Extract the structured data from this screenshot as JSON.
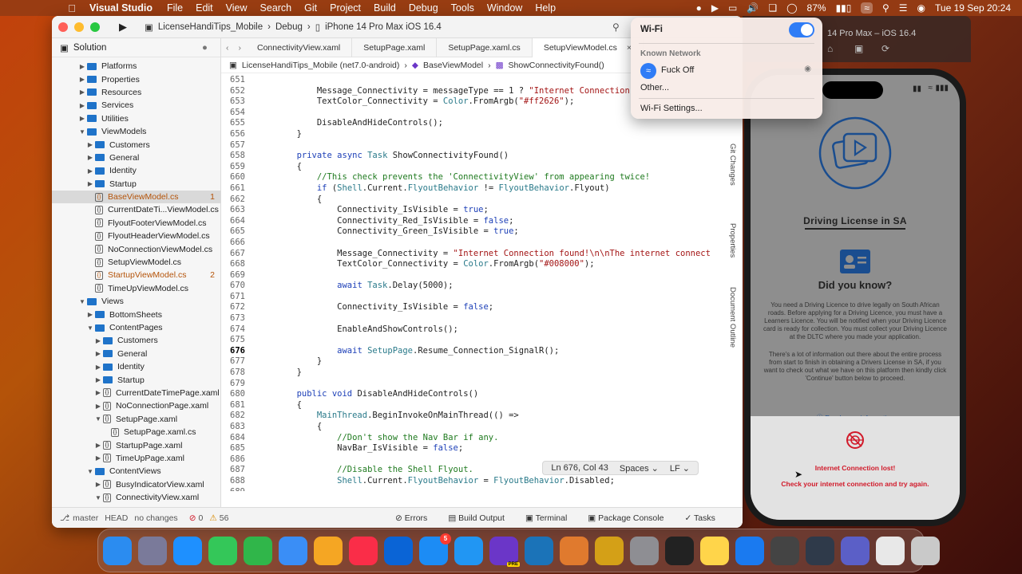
{
  "menubar": {
    "app_name": "Visual Studio",
    "items": [
      "File",
      "Edit",
      "View",
      "Search",
      "Git",
      "Project",
      "Build",
      "Debug",
      "Tools",
      "Window",
      "Help"
    ],
    "battery": "87%",
    "datetime": "Tue 19 Sep  20:24"
  },
  "toolbar": {
    "project": "LicenseHandiTips_Mobile",
    "config": "Debug",
    "device": "iPhone 14 Pro Max iOS 16.4"
  },
  "sidebar": {
    "title": "Solution",
    "items": [
      {
        "label": "Platforms",
        "depth": 3,
        "type": "folder",
        "chev": "▶"
      },
      {
        "label": "Properties",
        "depth": 3,
        "type": "folder",
        "chev": "▶"
      },
      {
        "label": "Resources",
        "depth": 3,
        "type": "folder",
        "chev": "▶"
      },
      {
        "label": "Services",
        "depth": 3,
        "type": "folder",
        "chev": "▶"
      },
      {
        "label": "Utilities",
        "depth": 3,
        "type": "folder",
        "chev": "▶"
      },
      {
        "label": "ViewModels",
        "depth": 3,
        "type": "folder",
        "chev": "▼"
      },
      {
        "label": "Customers",
        "depth": 4,
        "type": "folder",
        "chev": "▶"
      },
      {
        "label": "General",
        "depth": 4,
        "type": "folder",
        "chev": "▶"
      },
      {
        "label": "Identity",
        "depth": 4,
        "type": "folder",
        "chev": "▶"
      },
      {
        "label": "Startup",
        "depth": 4,
        "type": "folder",
        "chev": "▶"
      },
      {
        "label": "BaseViewModel.cs",
        "depth": 4,
        "type": "file",
        "badge": "1",
        "selected": true,
        "modified": true
      },
      {
        "label": "CurrentDateTi...ViewModel.cs",
        "depth": 4,
        "type": "file"
      },
      {
        "label": "FlyoutFooterViewModel.cs",
        "depth": 4,
        "type": "file"
      },
      {
        "label": "FlyoutHeaderViewModel.cs",
        "depth": 4,
        "type": "file"
      },
      {
        "label": "NoConnectionViewModel.cs",
        "depth": 4,
        "type": "file"
      },
      {
        "label": "SetupViewModel.cs",
        "depth": 4,
        "type": "file"
      },
      {
        "label": "StartupViewModel.cs",
        "depth": 4,
        "type": "file",
        "badge": "2",
        "modified": true
      },
      {
        "label": "TimeUpViewModel.cs",
        "depth": 4,
        "type": "file"
      },
      {
        "label": "Views",
        "depth": 3,
        "type": "folder",
        "chev": "▼"
      },
      {
        "label": "BottomSheets",
        "depth": 4,
        "type": "folder",
        "chev": "▶"
      },
      {
        "label": "ContentPages",
        "depth": 4,
        "type": "folder",
        "chev": "▼"
      },
      {
        "label": "Customers",
        "depth": 5,
        "type": "folder",
        "chev": "▶"
      },
      {
        "label": "General",
        "depth": 5,
        "type": "folder",
        "chev": "▶"
      },
      {
        "label": "Identity",
        "depth": 5,
        "type": "folder",
        "chev": "▶"
      },
      {
        "label": "Startup",
        "depth": 5,
        "type": "folder",
        "chev": "▶"
      },
      {
        "label": "CurrentDateTimePage.xaml",
        "depth": 5,
        "type": "file",
        "chev": "▶"
      },
      {
        "label": "NoConnectionPage.xaml",
        "depth": 5,
        "type": "file",
        "chev": "▶"
      },
      {
        "label": "SetupPage.xaml",
        "depth": 5,
        "type": "file",
        "chev": "▼"
      },
      {
        "label": "SetupPage.xaml.cs",
        "depth": 6,
        "type": "file"
      },
      {
        "label": "StartupPage.xaml",
        "depth": 5,
        "type": "file",
        "chev": "▶"
      },
      {
        "label": "TimeUpPage.xaml",
        "depth": 5,
        "type": "file",
        "chev": "▶"
      },
      {
        "label": "ContentViews",
        "depth": 4,
        "type": "folder",
        "chev": "▼"
      },
      {
        "label": "BusyIndicatorView.xaml",
        "depth": 5,
        "type": "file",
        "chev": "▶"
      },
      {
        "label": "ConnectivityView.xaml",
        "depth": 5,
        "type": "file",
        "chev": "▼"
      }
    ]
  },
  "tabs": [
    "ConnectivityView.xaml",
    "SetupPage.xaml",
    "SetupPage.xaml.cs",
    "SetupViewModel.cs"
  ],
  "breadcrumb": {
    "project": "LicenseHandiTips_Mobile (net7.0-android)",
    "class": "BaseViewModel",
    "method": "ShowConnectivityFound()"
  },
  "code": [
    {
      "n": "651",
      "t": ""
    },
    {
      "n": "652",
      "t": "            Message_Connectivity = messageType == 1 ? \"Internet Connection"
    },
    {
      "n": "653",
      "t": "            TextColor_Connectivity = Color.FromArgb(\"#ff2626\");"
    },
    {
      "n": "654",
      "t": ""
    },
    {
      "n": "655",
      "t": "            DisableAndHideControls();"
    },
    {
      "n": "656",
      "t": "        }"
    },
    {
      "n": "657",
      "t": ""
    },
    {
      "n": "658",
      "t": "        private async Task ShowConnectivityFound()"
    },
    {
      "n": "659",
      "t": "        {"
    },
    {
      "n": "660",
      "t": "            //This check prevents the 'ConnectivityView' from appearing twice!"
    },
    {
      "n": "661",
      "t": "            if (Shell.Current.FlyoutBehavior != FlyoutBehavior.Flyout)"
    },
    {
      "n": "662",
      "t": "            {"
    },
    {
      "n": "663",
      "t": "                Connectivity_IsVisible = true;"
    },
    {
      "n": "664",
      "t": "                Connectivity_Red_IsVisible = false;"
    },
    {
      "n": "665",
      "t": "                Connectivity_Green_IsVisible = true;"
    },
    {
      "n": "666",
      "t": ""
    },
    {
      "n": "667",
      "t": "                Message_Connectivity = \"Internet Connection found!\\n\\nThe internet connect"
    },
    {
      "n": "668",
      "t": "                TextColor_Connectivity = Color.FromArgb(\"#008000\");"
    },
    {
      "n": "669",
      "t": ""
    },
    {
      "n": "670",
      "t": "                await Task.Delay(5000);"
    },
    {
      "n": "671",
      "t": ""
    },
    {
      "n": "672",
      "t": "                Connectivity_IsVisible = false;"
    },
    {
      "n": "673",
      "t": ""
    },
    {
      "n": "674",
      "t": "                EnableAndShowControls();"
    },
    {
      "n": "675",
      "t": ""
    },
    {
      "n": "676",
      "t": "                await SetupPage.Resume_Connection_SignalR();",
      "current": true
    },
    {
      "n": "677",
      "t": "            }"
    },
    {
      "n": "678",
      "t": "        }"
    },
    {
      "n": "679",
      "t": ""
    },
    {
      "n": "680",
      "t": "        public void DisableAndHideControls()"
    },
    {
      "n": "681",
      "t": "        {"
    },
    {
      "n": "682",
      "t": "            MainThread.BeginInvokeOnMainThread(() =>"
    },
    {
      "n": "683",
      "t": "            {"
    },
    {
      "n": "684",
      "t": "                //Don't show the Nav Bar if any."
    },
    {
      "n": "685",
      "t": "                NavBar_IsVisible = false;"
    },
    {
      "n": "686",
      "t": ""
    },
    {
      "n": "687",
      "t": "                //Disable the Shell Flyout."
    },
    {
      "n": "688",
      "t": "                Shell.Current.FlyoutBehavior = FlyoutBehavior.Disabled;"
    },
    {
      "n": "689",
      "t": ""
    },
    {
      "n": "690",
      "t": "                //Disable the Shell bottom Tabs."
    }
  ],
  "editor_status": {
    "position": "Ln 676, Col 43",
    "indent": "Spaces",
    "eol": "LF"
  },
  "statusbar": {
    "branch": "master",
    "head": "HEAD",
    "changes": "no changes",
    "errors": "0",
    "warnings": "56",
    "panels": [
      "Errors",
      "Build Output",
      "Terminal",
      "Package Console",
      "Tasks"
    ]
  },
  "side_rail": [
    "Git Changes",
    "Properties",
    "Document Outline"
  ],
  "simulator": {
    "title": "14 Pro Max – iOS 16.4",
    "app_title": "Driving License in SA",
    "did_you_know": "Did you know?",
    "para1": "You need a Driving Licence to drive legally on South African roads. Before applying for a Driving Licence, you must have a Learners Licence. You will be notified when your Driving Licence card is ready for collection. You must collect your Driving Licence at the DLTC where you made your application.",
    "para2": "There's a lot of information out there about the entire process from start to finish in obtaining a Drivers License in SA, if you want to check out what we have on this platform then kindly click 'Continue' button below to proceed.",
    "read_more": "Read more information",
    "lost_title": "Internet Connection lost!",
    "lost_msg": "Check your internet connection and try again."
  },
  "wifi_menu": {
    "title": "Wi-Fi",
    "section": "Known Network",
    "network": "Fuck Off",
    "other": "Other...",
    "settings": "Wi-Fi Settings...",
    "enabled": true
  },
  "dock": [
    {
      "name": "finder-icon",
      "color": "#2b8cf0"
    },
    {
      "name": "launchpad-icon",
      "color": "#7a7a9a"
    },
    {
      "name": "safari-icon",
      "color": "#1e90ff"
    },
    {
      "name": "messages-icon",
      "color": "#34c759"
    },
    {
      "name": "facetime-icon",
      "color": "#30b64a"
    },
    {
      "name": "mail-icon",
      "color": "#3a8ef6"
    },
    {
      "name": "photos-icon",
      "color": "#f5a623"
    },
    {
      "name": "music-icon",
      "color": "#fa2d48"
    },
    {
      "name": "onedrive-icon",
      "color": "#0a64d6"
    },
    {
      "name": "appstore-icon",
      "color": "#1c8cf5",
      "badge": "5"
    },
    {
      "name": "xcode-appstore-icon",
      "color": "#2196f3"
    },
    {
      "name": "visual-studio-icon",
      "color": "#6b36c8",
      "label": "PRE"
    },
    {
      "name": "wireshark-icon",
      "color": "#1b73b8"
    },
    {
      "name": "game-icon",
      "color": "#e07a2e"
    },
    {
      "name": "pineapple-icon",
      "color": "#d4a017"
    },
    {
      "name": "settings-icon",
      "color": "#8e8e93"
    },
    {
      "name": "voice-memos-icon",
      "color": "#222"
    },
    {
      "name": "notes-icon",
      "color": "#ffd54a"
    },
    {
      "name": "xcode-icon",
      "color": "#1a7af0"
    },
    {
      "name": "instruments-icon",
      "color": "#444"
    },
    {
      "name": "simulator-icon",
      "color": "#2f3a4a"
    },
    {
      "name": "teams-icon",
      "color": "#5b5fc7"
    },
    {
      "name": "archive-icon",
      "color": "#e8e8e8"
    },
    {
      "name": "trash-icon",
      "color": "#c9c9c9"
    }
  ]
}
